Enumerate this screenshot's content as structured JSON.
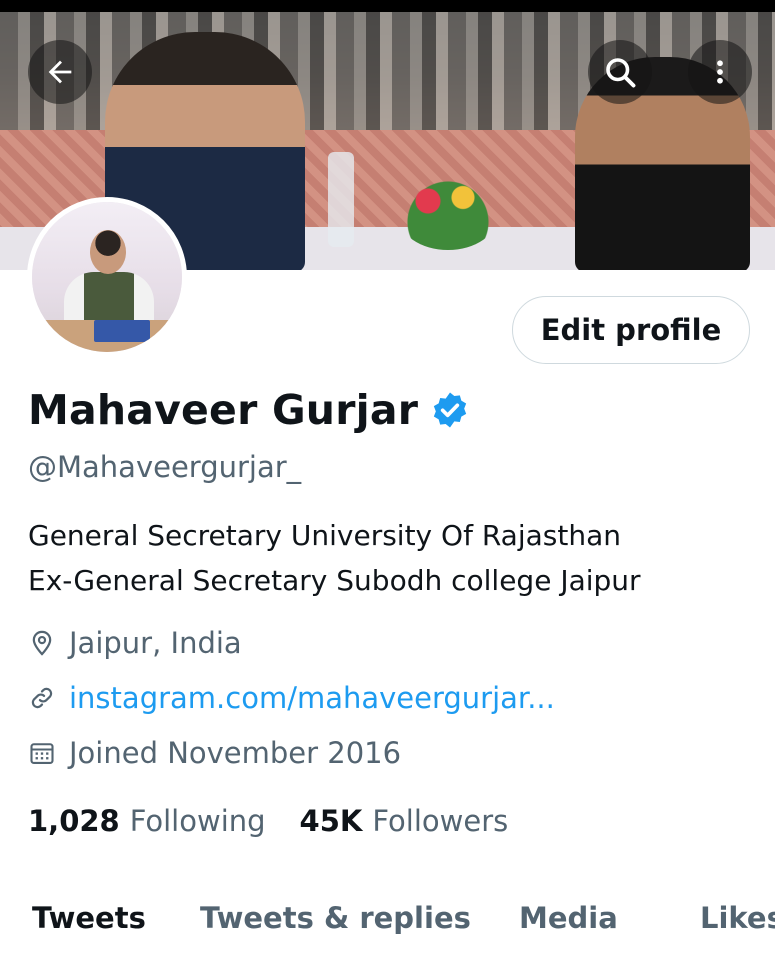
{
  "header": {
    "icons": {
      "back": "arrow-left-icon",
      "search": "search-icon",
      "more": "more-vertical-icon"
    }
  },
  "profile": {
    "name": "Mahaveer Gurjar",
    "verified": true,
    "handle": "@Mahaveergurjar_",
    "edit_button_label": "Edit profile",
    "bio_line1": "General Secretary University Of Rajasthan",
    "bio_line2": "Ex-General Secretary Subodh college Jaipur",
    "location": "Jaipur, India",
    "link": "instagram.com/mahaveergurjar...",
    "joined": "Joined November 2016"
  },
  "stats": {
    "following_count": "1,028",
    "following_label": "Following",
    "followers_count": "45K",
    "followers_label": "Followers"
  },
  "tabs": [
    {
      "label": "Tweets",
      "active": true
    },
    {
      "label": "Tweets & replies",
      "active": false
    },
    {
      "label": "Media",
      "active": false
    },
    {
      "label": "Likes",
      "active": false
    }
  ],
  "colors": {
    "accent": "#1d9bf0",
    "text_primary": "#0f1419",
    "text_secondary": "#536471",
    "border": "#cfd9de"
  }
}
